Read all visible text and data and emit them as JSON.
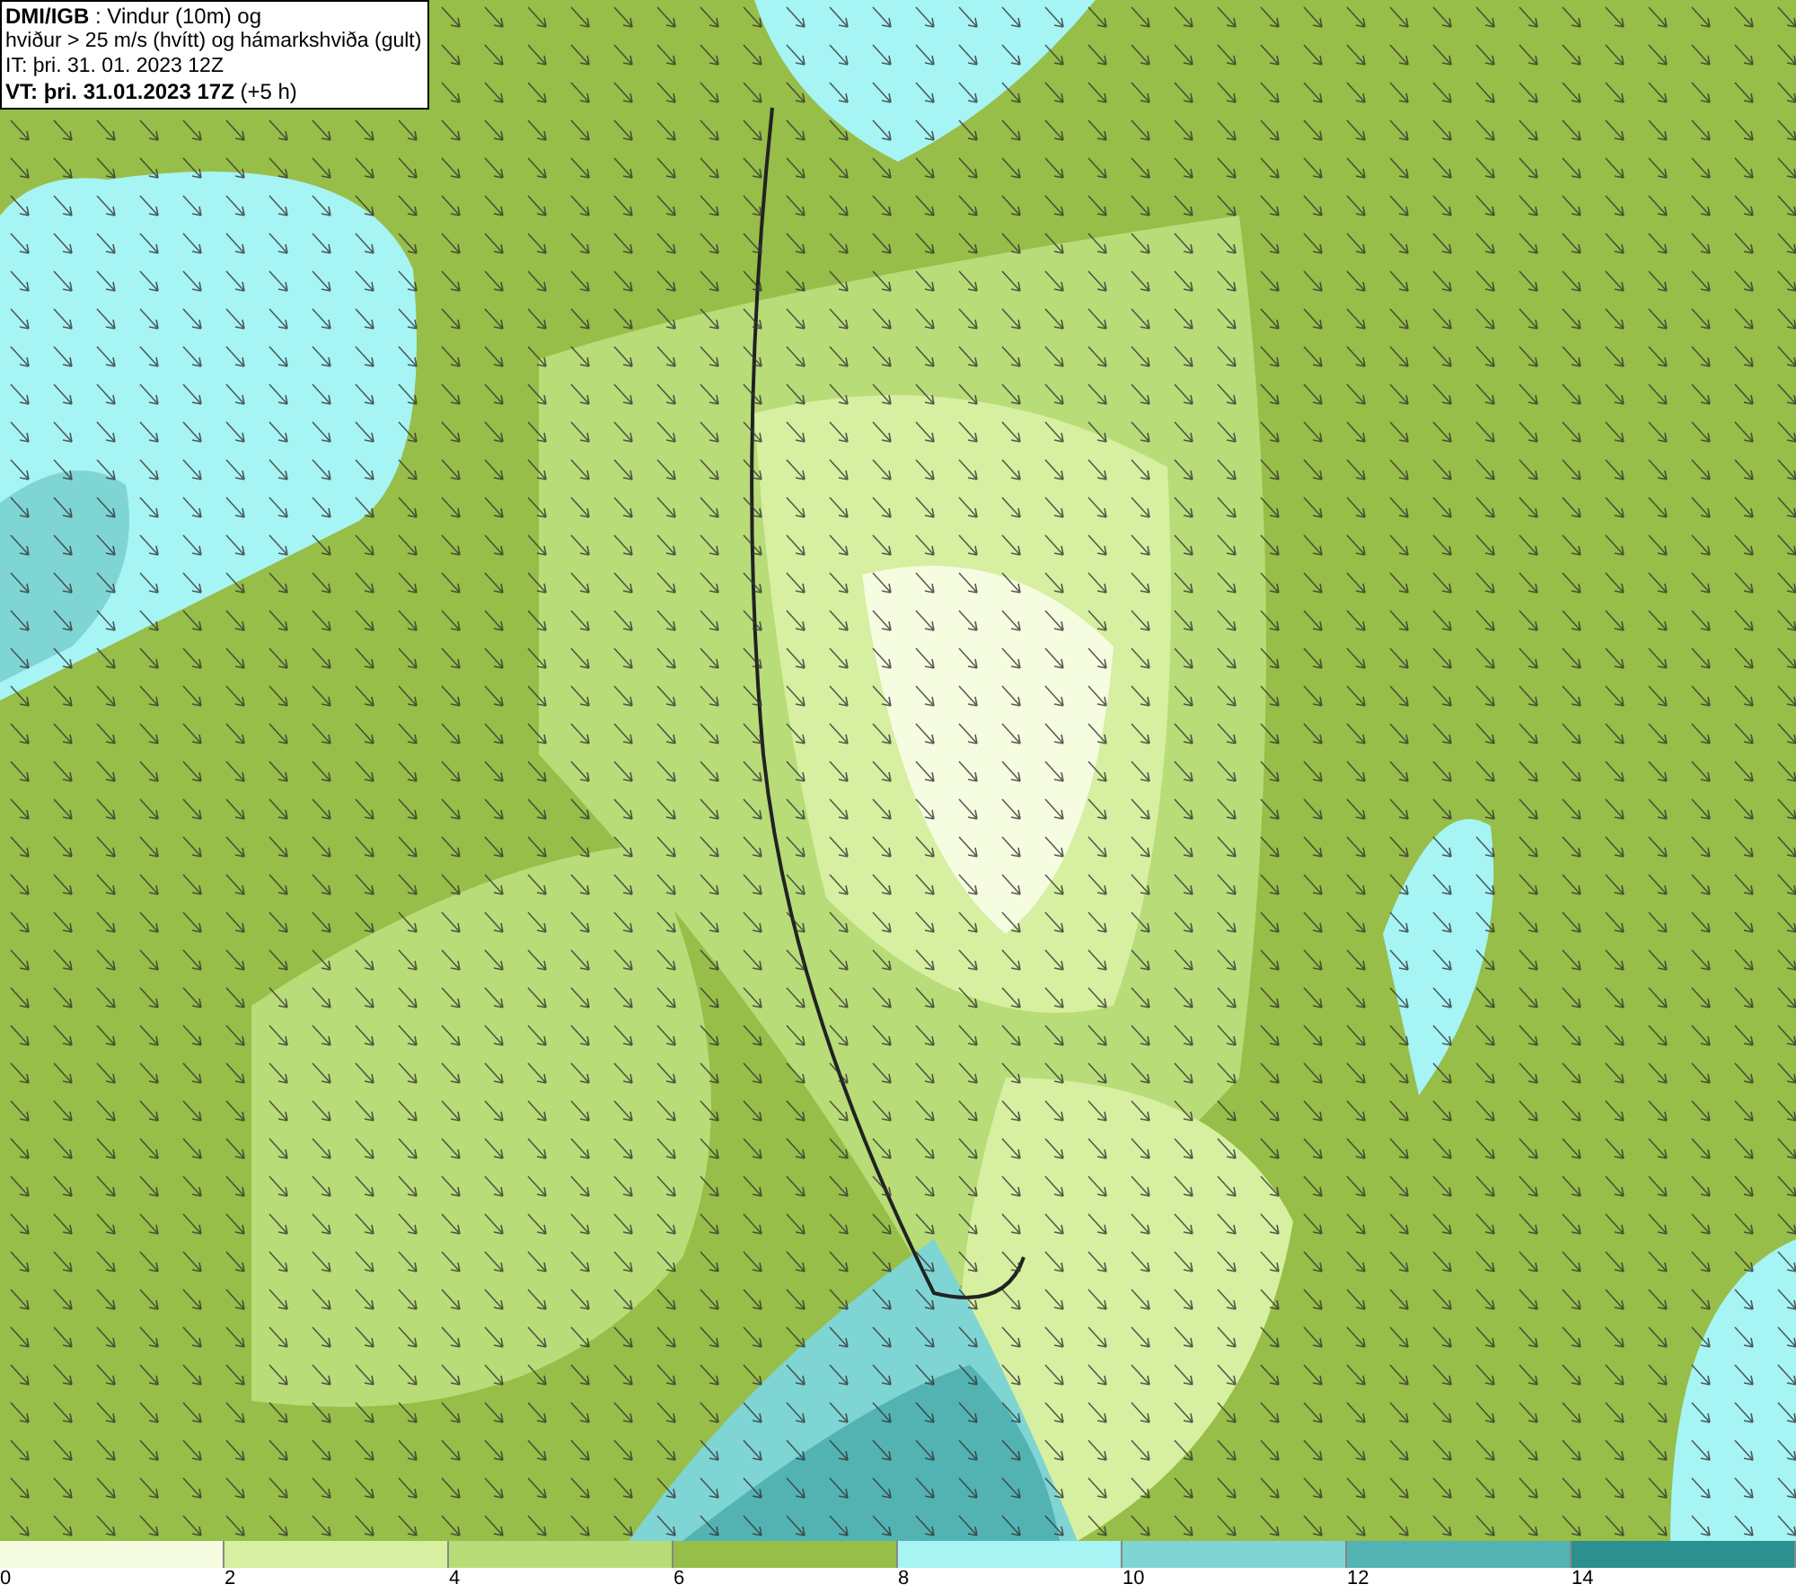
{
  "header": {
    "lines": [
      "**DMI/IGB** : Vindur (10m) og",
      "hviður > 25 m/s (hvítt) og hámarkshviða (gult)",
      "IT: þri. 31. 01. 2023 12Z",
      "**VT: þri. 31.01.2023 17Z** (+5 h)"
    ]
  },
  "legend": {
    "bins": [
      {
        "color": "#f5fce0",
        "label": "0"
      },
      {
        "color": "#d6efa0",
        "label": "2"
      },
      {
        "color": "#b8dc78",
        "label": "4"
      },
      {
        "color": "#96be48",
        "label": "6"
      },
      {
        "color": "#a6f4f4",
        "label": "8"
      },
      {
        "color": "#7fd4d4",
        "label": "10"
      },
      {
        "color": "#53b3b3",
        "label": "12"
      },
      {
        "color": "#2a9090",
        "label": "14"
      }
    ]
  }
}
